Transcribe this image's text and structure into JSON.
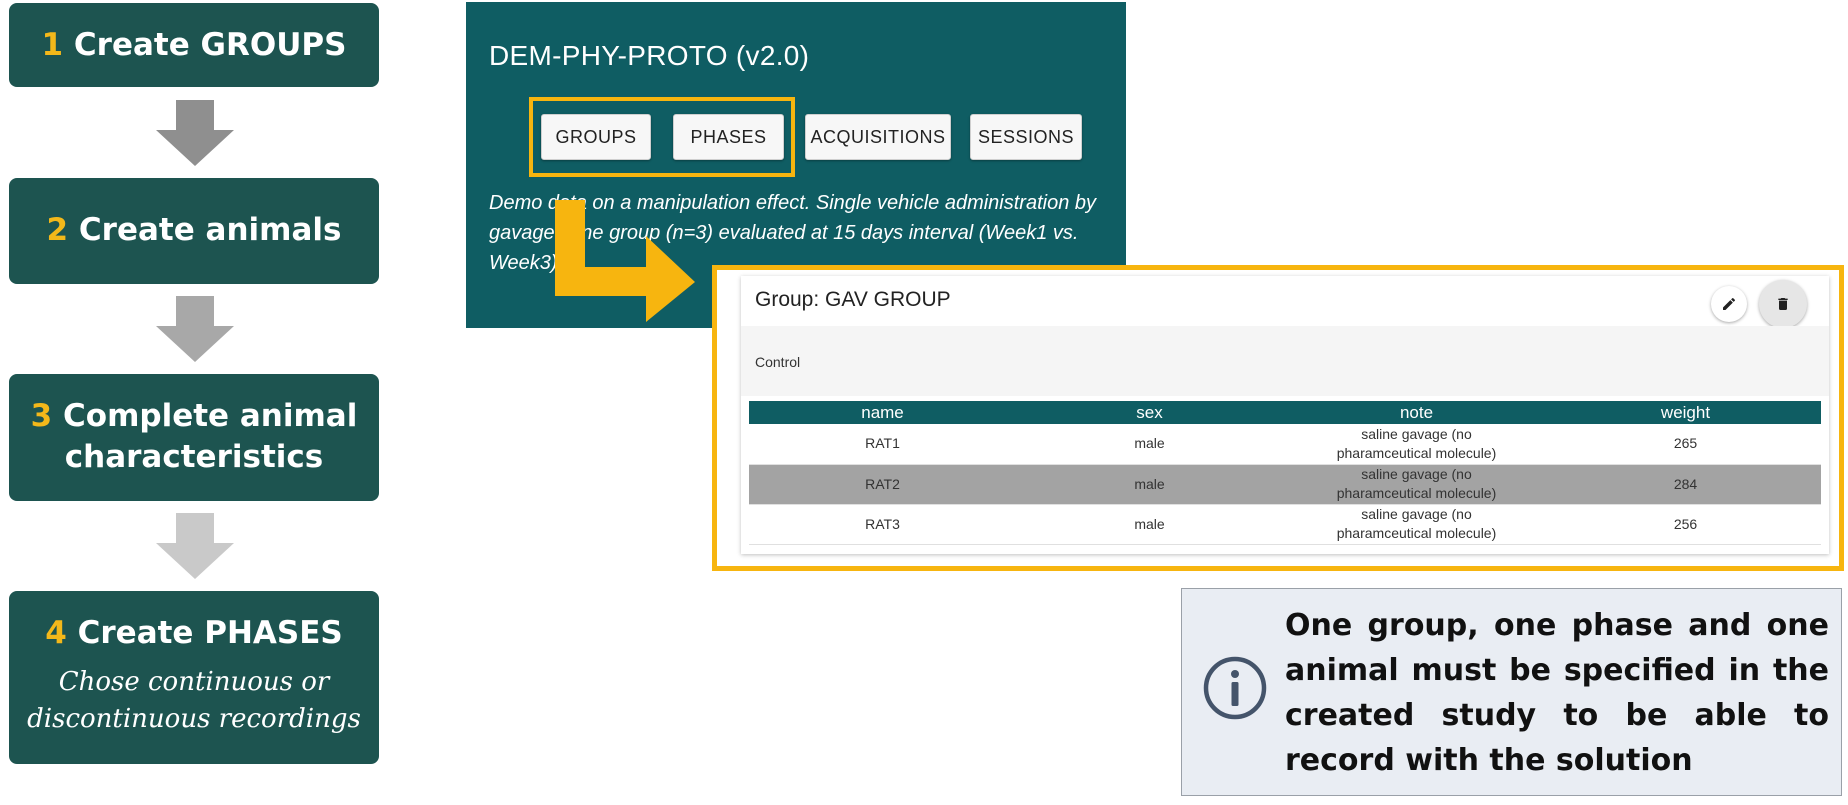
{
  "steps": [
    {
      "num": "1",
      "title": "Create GROUPS",
      "subtitle": ""
    },
    {
      "num": "2",
      "title": "Create animals",
      "subtitle": ""
    },
    {
      "num": "3",
      "title": "Complete animal",
      "title_line2": "characteristics",
      "subtitle": ""
    },
    {
      "num": "4",
      "title": "Create PHASES",
      "subtitle_line1": "Chose continuous or",
      "subtitle_line2": "discontinuous recordings"
    }
  ],
  "app": {
    "title": "DEM-PHY-PROTO (v2.0)",
    "nav": [
      "GROUPS",
      "PHASES",
      "ACQUISITIONS",
      "SESSIONS"
    ],
    "description": "Demo data on a manipulation effect. Single vehicle administration by gavage. One group (n=3) evaluated at 15 days interval (Week1 vs. Week3)."
  },
  "group": {
    "title": "Group: GAV GROUP",
    "description": "Control",
    "columns": [
      "name",
      "sex",
      "note",
      "weight"
    ],
    "rows": [
      {
        "name": "RAT1",
        "sex": "male",
        "note": "saline gavage (no pharamceutical molecule)",
        "weight": "265"
      },
      {
        "name": "RAT2",
        "sex": "male",
        "note": "saline gavage (no pharamceutical molecule)",
        "weight": "284"
      },
      {
        "name": "RAT3",
        "sex": "male",
        "note": "saline gavage (no pharamceutical molecule)",
        "weight": "256"
      }
    ]
  },
  "info": {
    "text": "One group, one phase and one animal must be specified in the created study to be able to record with the solution"
  },
  "icons": {
    "edit": "pencil-icon",
    "delete": "trash-icon",
    "info": "info-circle-icon"
  },
  "colors": {
    "step_bg": "#1d5450",
    "accent": "#f3b81a",
    "app_bg": "#0f5d63",
    "highlight": "#f7b50f",
    "info_bg": "#e9edf3"
  }
}
